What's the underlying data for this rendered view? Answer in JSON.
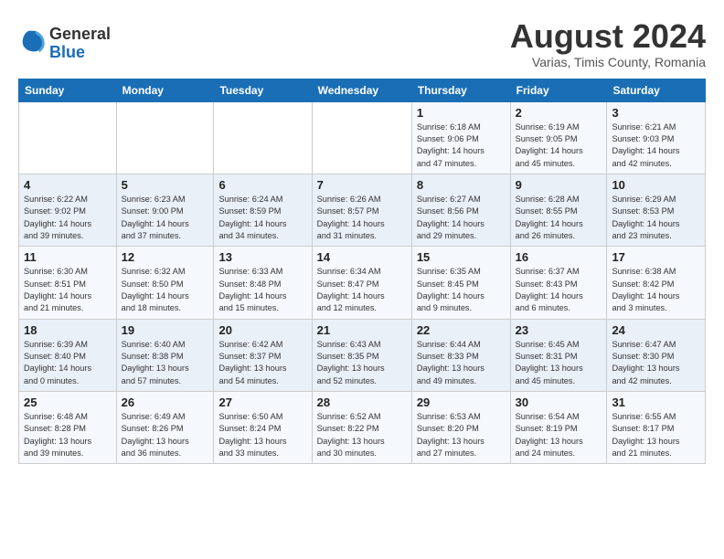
{
  "logo": {
    "general": "General",
    "blue": "Blue"
  },
  "title": "August 2024",
  "location": "Varias, Timis County, Romania",
  "days_header": [
    "Sunday",
    "Monday",
    "Tuesday",
    "Wednesday",
    "Thursday",
    "Friday",
    "Saturday"
  ],
  "weeks": [
    [
      {
        "day": "",
        "info": ""
      },
      {
        "day": "",
        "info": ""
      },
      {
        "day": "",
        "info": ""
      },
      {
        "day": "",
        "info": ""
      },
      {
        "day": "1",
        "info": "Sunrise: 6:18 AM\nSunset: 9:06 PM\nDaylight: 14 hours\nand 47 minutes."
      },
      {
        "day": "2",
        "info": "Sunrise: 6:19 AM\nSunset: 9:05 PM\nDaylight: 14 hours\nand 45 minutes."
      },
      {
        "day": "3",
        "info": "Sunrise: 6:21 AM\nSunset: 9:03 PM\nDaylight: 14 hours\nand 42 minutes."
      }
    ],
    [
      {
        "day": "4",
        "info": "Sunrise: 6:22 AM\nSunset: 9:02 PM\nDaylight: 14 hours\nand 39 minutes."
      },
      {
        "day": "5",
        "info": "Sunrise: 6:23 AM\nSunset: 9:00 PM\nDaylight: 14 hours\nand 37 minutes."
      },
      {
        "day": "6",
        "info": "Sunrise: 6:24 AM\nSunset: 8:59 PM\nDaylight: 14 hours\nand 34 minutes."
      },
      {
        "day": "7",
        "info": "Sunrise: 6:26 AM\nSunset: 8:57 PM\nDaylight: 14 hours\nand 31 minutes."
      },
      {
        "day": "8",
        "info": "Sunrise: 6:27 AM\nSunset: 8:56 PM\nDaylight: 14 hours\nand 29 minutes."
      },
      {
        "day": "9",
        "info": "Sunrise: 6:28 AM\nSunset: 8:55 PM\nDaylight: 14 hours\nand 26 minutes."
      },
      {
        "day": "10",
        "info": "Sunrise: 6:29 AM\nSunset: 8:53 PM\nDaylight: 14 hours\nand 23 minutes."
      }
    ],
    [
      {
        "day": "11",
        "info": "Sunrise: 6:30 AM\nSunset: 8:51 PM\nDaylight: 14 hours\nand 21 minutes."
      },
      {
        "day": "12",
        "info": "Sunrise: 6:32 AM\nSunset: 8:50 PM\nDaylight: 14 hours\nand 18 minutes."
      },
      {
        "day": "13",
        "info": "Sunrise: 6:33 AM\nSunset: 8:48 PM\nDaylight: 14 hours\nand 15 minutes."
      },
      {
        "day": "14",
        "info": "Sunrise: 6:34 AM\nSunset: 8:47 PM\nDaylight: 14 hours\nand 12 minutes."
      },
      {
        "day": "15",
        "info": "Sunrise: 6:35 AM\nSunset: 8:45 PM\nDaylight: 14 hours\nand 9 minutes."
      },
      {
        "day": "16",
        "info": "Sunrise: 6:37 AM\nSunset: 8:43 PM\nDaylight: 14 hours\nand 6 minutes."
      },
      {
        "day": "17",
        "info": "Sunrise: 6:38 AM\nSunset: 8:42 PM\nDaylight: 14 hours\nand 3 minutes."
      }
    ],
    [
      {
        "day": "18",
        "info": "Sunrise: 6:39 AM\nSunset: 8:40 PM\nDaylight: 14 hours\nand 0 minutes."
      },
      {
        "day": "19",
        "info": "Sunrise: 6:40 AM\nSunset: 8:38 PM\nDaylight: 13 hours\nand 57 minutes."
      },
      {
        "day": "20",
        "info": "Sunrise: 6:42 AM\nSunset: 8:37 PM\nDaylight: 13 hours\nand 54 minutes."
      },
      {
        "day": "21",
        "info": "Sunrise: 6:43 AM\nSunset: 8:35 PM\nDaylight: 13 hours\nand 52 minutes."
      },
      {
        "day": "22",
        "info": "Sunrise: 6:44 AM\nSunset: 8:33 PM\nDaylight: 13 hours\nand 49 minutes."
      },
      {
        "day": "23",
        "info": "Sunrise: 6:45 AM\nSunset: 8:31 PM\nDaylight: 13 hours\nand 45 minutes."
      },
      {
        "day": "24",
        "info": "Sunrise: 6:47 AM\nSunset: 8:30 PM\nDaylight: 13 hours\nand 42 minutes."
      }
    ],
    [
      {
        "day": "25",
        "info": "Sunrise: 6:48 AM\nSunset: 8:28 PM\nDaylight: 13 hours\nand 39 minutes."
      },
      {
        "day": "26",
        "info": "Sunrise: 6:49 AM\nSunset: 8:26 PM\nDaylight: 13 hours\nand 36 minutes."
      },
      {
        "day": "27",
        "info": "Sunrise: 6:50 AM\nSunset: 8:24 PM\nDaylight: 13 hours\nand 33 minutes."
      },
      {
        "day": "28",
        "info": "Sunrise: 6:52 AM\nSunset: 8:22 PM\nDaylight: 13 hours\nand 30 minutes."
      },
      {
        "day": "29",
        "info": "Sunrise: 6:53 AM\nSunset: 8:20 PM\nDaylight: 13 hours\nand 27 minutes."
      },
      {
        "day": "30",
        "info": "Sunrise: 6:54 AM\nSunset: 8:19 PM\nDaylight: 13 hours\nand 24 minutes."
      },
      {
        "day": "31",
        "info": "Sunrise: 6:55 AM\nSunset: 8:17 PM\nDaylight: 13 hours\nand 21 minutes."
      }
    ]
  ]
}
